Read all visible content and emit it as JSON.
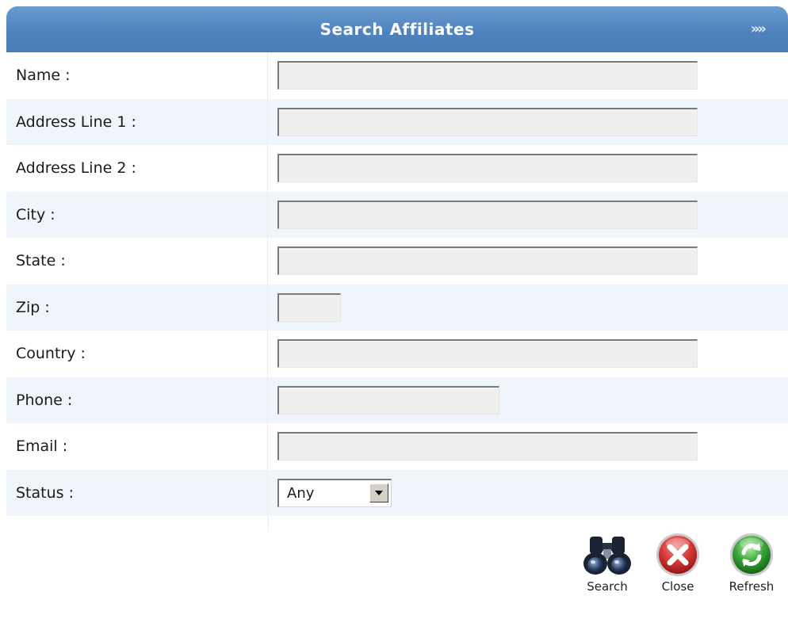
{
  "header": {
    "title": "Search Affiliates",
    "arrows": "»»"
  },
  "fields": {
    "name": {
      "label": "Name :",
      "value": ""
    },
    "address1": {
      "label": "Address Line 1 :",
      "value": ""
    },
    "address2": {
      "label": "Address Line 2 :",
      "value": ""
    },
    "city": {
      "label": "City :",
      "value": ""
    },
    "state": {
      "label": "State :",
      "value": ""
    },
    "zip": {
      "label": "Zip :",
      "value": ""
    },
    "country": {
      "label": "Country :",
      "value": ""
    },
    "phone": {
      "label": "Phone :",
      "value": ""
    },
    "email": {
      "label": "Email :",
      "value": ""
    },
    "status": {
      "label": "Status :",
      "value": "Any"
    }
  },
  "actions": {
    "search": "Search",
    "close": "Close",
    "refresh": "Refresh"
  },
  "icons": {
    "search": "binoculars-icon",
    "close": "close-icon",
    "refresh": "refresh-icon",
    "dropdown": "chevron-down-icon"
  },
  "colors": {
    "header": "#4f83bf",
    "row_alt": "#f0f5fb",
    "input_bg": "#efefef",
    "close_red": "#d83a3a",
    "refresh_green": "#3aa43a"
  }
}
